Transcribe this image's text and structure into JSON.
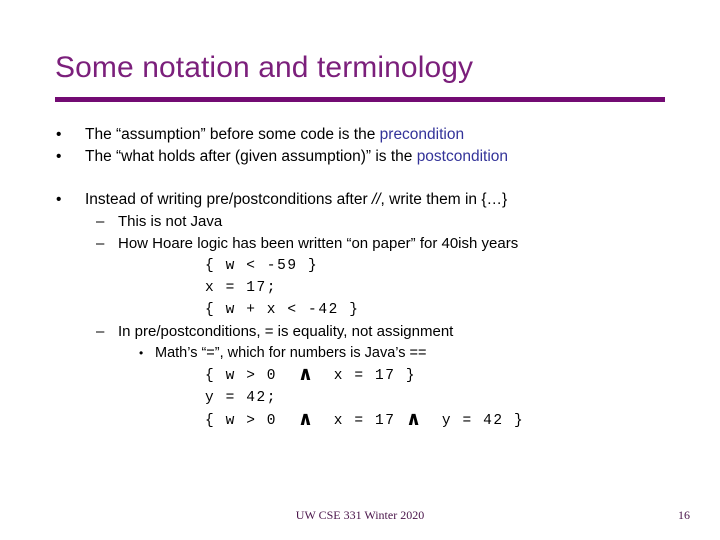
{
  "slide": {
    "title": "Some notation and terminology",
    "accent_color": "#7B1F7B",
    "rule_color": "#730B73",
    "highlight_color": "#333399",
    "body_color": "#000000",
    "background_color": "#FFFFFF"
  },
  "bullets": {
    "b1_marker": "•",
    "b1_text_a": "The “assumption” before some code is the ",
    "b1_text_b": "precondition",
    "b2_marker": "•",
    "b2_text_a": "The “what holds after (given assumption)” is the ",
    "b2_text_b": "postcondition",
    "b3_marker": "•",
    "b3_text_a": "Instead of writing pre/postconditions after ",
    "b3_text_b": "//",
    "b3_text_c": ", write them in {…}",
    "b4_marker": "–",
    "b4_text": "This is not Java",
    "b5_marker": "–",
    "b5_text": "How Hoare logic has been written “on paper” for 40ish years",
    "b6_marker": "–",
    "b6_text": "In pre/postconditions, = is equality, not assignment",
    "b7_marker": "•",
    "b7_text": "Math’s “=”, which for numbers is Java’s =="
  },
  "code_block_1": {
    "line1": "{ w < -59 }",
    "line2": "x = 17;",
    "line3": "{ w + x < -42 }"
  },
  "code_block_2": {
    "line1_pre": "{ w > 0  ",
    "line1_and": "∧",
    "line1_post": "  x = 17 }",
    "line2": "y = 42;",
    "line3_pre": "{ w > 0  ",
    "line3_and1": "∧",
    "line3_mid": "  x = 17 ",
    "line3_and2": "∧",
    "line3_post": "  y = 42 }"
  },
  "footer": {
    "course": "UW CSE 331 Winter 2020",
    "page_number": "16"
  }
}
